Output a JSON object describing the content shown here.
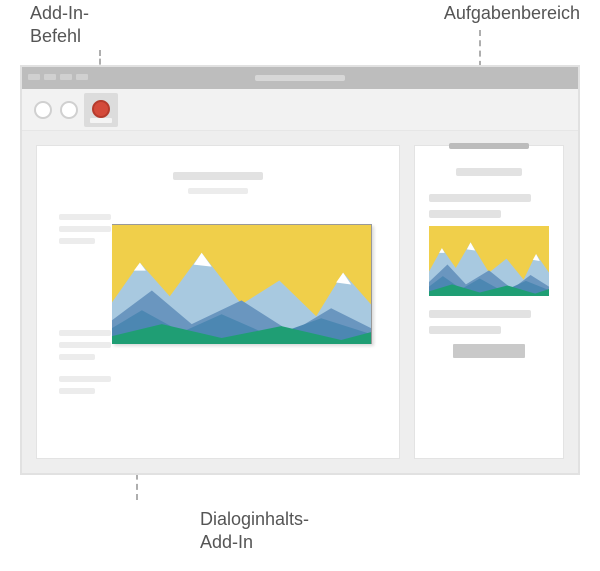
{
  "labels": {
    "addin_command": "Add-In-\nBefehl",
    "task_pane": "Aufgabenbereich",
    "dialog_content_addin": "Dialoginhalts-\nAdd-In"
  },
  "colors": {
    "sky": "#f0cf4a",
    "sun": "#e9553b",
    "far_mountain": "#6a96bf",
    "mid_mountain": "#a8c9e0",
    "near_mountain": "#4c87b2",
    "ground": "#1f9e74",
    "snow": "#ffffff",
    "addin_button_dot": "#d44a3a"
  },
  "callouts": {
    "addin_command": {
      "target": "ribbon add-in command button"
    },
    "task_pane": {
      "target": "task pane panel"
    },
    "dialog_content_addin": {
      "target": "content add-in inside document"
    }
  }
}
